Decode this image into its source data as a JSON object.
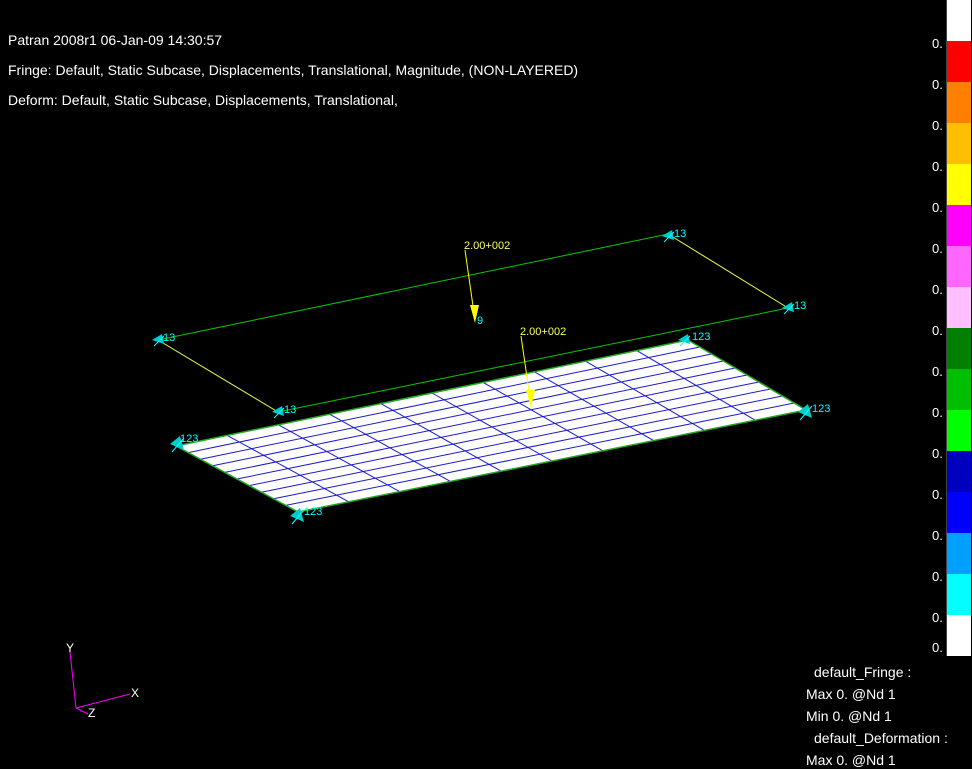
{
  "header": {
    "title": "Patran 2008r1 06-Jan-09 14:30:57",
    "fringe": "Fringe: Default, Static Subcase, Displacements, Translational, Magnitude, (NON-LAYERED)",
    "deform": "Deform: Default, Static Subcase, Displacements, Translational,"
  },
  "loads": [
    {
      "label": "2.00+002"
    },
    {
      "label": "2.00+002"
    }
  ],
  "constraints": {
    "upper": [
      "13",
      "13",
      "13",
      "13"
    ],
    "lower": [
      "123",
      "123",
      "123",
      "123"
    ]
  },
  "load_marker": "9",
  "axes": {
    "x": "X",
    "y": "Y",
    "z": "Z"
  },
  "fringe_scale": {
    "colors": [
      "#ffffff",
      "#ff0000",
      "#ff7f00",
      "#ffbf00",
      "#ffff00",
      "#ff00ff",
      "#ff66ff",
      "#ffbfff",
      "#007f00",
      "#00bf00",
      "#00ff00",
      "#0000bf",
      "#0000ff",
      "#00a0ff",
      "#00ffff",
      "#ffffff"
    ],
    "labels": [
      "0.",
      "0.",
      "0.",
      "0.",
      "0.",
      "0.",
      "0.",
      "0.",
      "0.",
      "0.",
      "0.",
      "0.",
      "0.",
      "0.",
      "0.",
      "0."
    ]
  },
  "result_info": {
    "fringe_title": "default_Fringe :",
    "fringe_max": "Max  0. @Nd 1",
    "fringe_min": "Min  0. @Nd 1",
    "deform_title": "default_Deformation :",
    "deform_max": "Max  0. @Nd 1"
  }
}
